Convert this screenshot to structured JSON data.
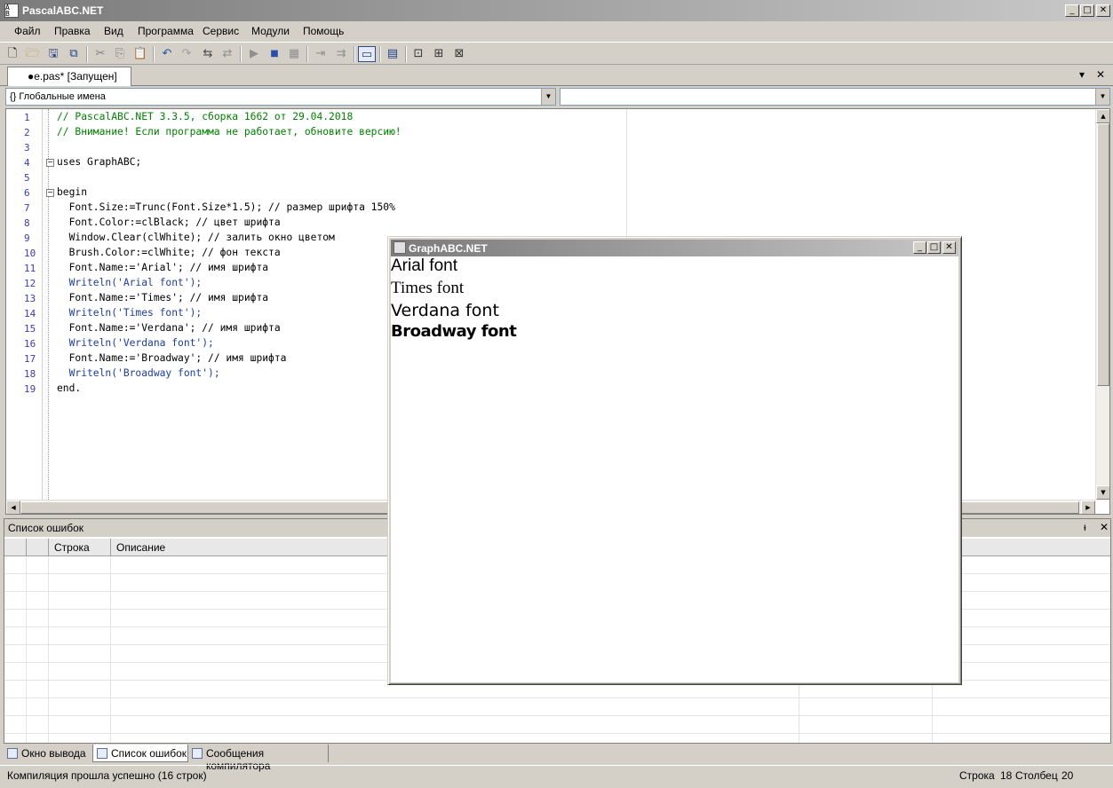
{
  "app": {
    "title": "PascalABC.NET"
  },
  "window_controls": {
    "minimize": "_",
    "maximize": "□",
    "close": "✕"
  },
  "menu": [
    "Файл",
    "Правка",
    "Вид",
    "Программа",
    "Сервис",
    "Модули",
    "Помощь"
  ],
  "toolbar": {
    "buttons": [
      "new-file-icon",
      "open-folder-icon",
      "save-icon",
      "save-all-icon",
      "cut-icon",
      "copy-icon",
      "paste-icon",
      "undo-icon",
      "redo-icon",
      "comment-icon",
      "uncomment-icon",
      "run-icon",
      "stop-icon",
      "compile-icon",
      "step-in-icon",
      "step-over-icon",
      "output-window-icon",
      "format-icon",
      "debug-step-icon",
      "debug-into-icon",
      "debug-run-icon"
    ],
    "pressed": "output-window-icon"
  },
  "document_tab": {
    "label": "●e.pas* [Запущен]",
    "menu": "▾",
    "close": "✕"
  },
  "navigation": {
    "scope_combo": "{} Глобальные имена",
    "member_combo": ""
  },
  "editor": {
    "lines": [
      "// PascalABC.NET 3.3.5, сборка 1662 от 29.04.2018",
      "// Внимание! Если программа не работает, обновите версию!",
      "",
      "uses GraphABC;",
      "",
      "begin",
      "  Font.Size:=Trunc(Font.Size*1.5); // размер шрифта 150%",
      "  Font.Color:=clBlack; // цвет шрифта",
      "  Window.Clear(clWhite); // залить окно цветом",
      "  Brush.Color:=clWhite; // фон текста",
      "  Font.Name:='Arial'; // имя шрифта",
      "  Writeln('Arial font');",
      "  Font.Name:='Times'; // имя шрифта",
      "  Writeln('Times font');",
      "  Font.Name:='Verdana'; // имя шрифта",
      "  Writeln('Verdana font');",
      "  Font.Name:='Broadway'; // имя шрифта",
      "  Writeln('Broadway font');",
      "end."
    ]
  },
  "error_panel": {
    "title": "Список ошибок",
    "pin": "ᵻ",
    "close": "✕",
    "columns": [
      "",
      "",
      "Строка",
      "Описание"
    ]
  },
  "bottom_tabs": [
    "Окно вывода",
    "Список ошибок",
    "Сообщения компилятора"
  ],
  "bottom_tabs_active": "Список ошибок",
  "status": {
    "message": "Компиляция прошла успешно (16 строк)",
    "row_label": "Строка",
    "row_value": "18",
    "col_label": "Столбец",
    "col_value": "20"
  },
  "graph_window": {
    "title": "GraphABC.NET",
    "output_lines": [
      "Arial font",
      "Times font",
      "Verdana font",
      "Broadway font"
    ]
  }
}
